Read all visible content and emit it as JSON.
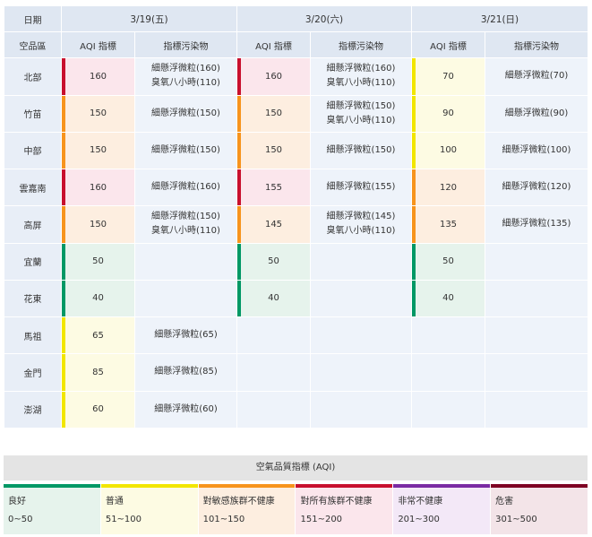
{
  "header": {
    "date_label": "日期",
    "area_label": "空品區",
    "aqi_label": "AQI 指標",
    "pollutant_label": "指標污染物"
  },
  "dates": [
    "3/19(五)",
    "3/20(六)",
    "3/21(日)"
  ],
  "regions": [
    {
      "name": "北部",
      "days": [
        {
          "aqi": "160",
          "color": "#c8102e",
          "bg": "#fbe6ec",
          "pollutants": [
            "細懸浮微粒(160)",
            "臭氧八小時(110)"
          ]
        },
        {
          "aqi": "160",
          "color": "#c8102e",
          "bg": "#fbe6ec",
          "pollutants": [
            "細懸浮微粒(160)",
            "臭氧八小時(110)"
          ]
        },
        {
          "aqi": "70",
          "color": "#f2e600",
          "bg": "#fdfbe3",
          "pollutants": [
            "細懸浮微粒(70)"
          ]
        }
      ]
    },
    {
      "name": "竹苗",
      "days": [
        {
          "aqi": "150",
          "color": "#f7941d",
          "bg": "#fdeee0",
          "pollutants": [
            "細懸浮微粒(150)"
          ]
        },
        {
          "aqi": "150",
          "color": "#f7941d",
          "bg": "#fdeee0",
          "pollutants": [
            "細懸浮微粒(150)",
            "臭氧八小時(110)"
          ]
        },
        {
          "aqi": "90",
          "color": "#f2e600",
          "bg": "#fdfbe3",
          "pollutants": [
            "細懸浮微粒(90)"
          ]
        }
      ]
    },
    {
      "name": "中部",
      "days": [
        {
          "aqi": "150",
          "color": "#f7941d",
          "bg": "#fdeee0",
          "pollutants": [
            "細懸浮微粒(150)"
          ]
        },
        {
          "aqi": "150",
          "color": "#f7941d",
          "bg": "#fdeee0",
          "pollutants": [
            "細懸浮微粒(150)"
          ]
        },
        {
          "aqi": "100",
          "color": "#f2e600",
          "bg": "#fdfbe3",
          "pollutants": [
            "細懸浮微粒(100)"
          ]
        }
      ]
    },
    {
      "name": "雲嘉南",
      "days": [
        {
          "aqi": "160",
          "color": "#c8102e",
          "bg": "#fbe6ec",
          "pollutants": [
            "細懸浮微粒(160)"
          ]
        },
        {
          "aqi": "155",
          "color": "#c8102e",
          "bg": "#fbe6ec",
          "pollutants": [
            "細懸浮微粒(155)"
          ]
        },
        {
          "aqi": "120",
          "color": "#f7941d",
          "bg": "#fdeee0",
          "pollutants": [
            "細懸浮微粒(120)"
          ]
        }
      ]
    },
    {
      "name": "高屏",
      "days": [
        {
          "aqi": "150",
          "color": "#f7941d",
          "bg": "#fdeee0",
          "pollutants": [
            "細懸浮微粒(150)",
            "臭氧八小時(110)"
          ]
        },
        {
          "aqi": "145",
          "color": "#f7941d",
          "bg": "#fdeee0",
          "pollutants": [
            "細懸浮微粒(145)",
            "臭氧八小時(110)"
          ]
        },
        {
          "aqi": "135",
          "color": "#f7941d",
          "bg": "#fdeee0",
          "pollutants": [
            "細懸浮微粒(135)"
          ]
        }
      ]
    },
    {
      "name": "宜蘭",
      "days": [
        {
          "aqi": "50",
          "color": "#009865",
          "bg": "#e6f3ec",
          "pollutants": []
        },
        {
          "aqi": "50",
          "color": "#009865",
          "bg": "#e6f3ec",
          "pollutants": []
        },
        {
          "aqi": "50",
          "color": "#009865",
          "bg": "#e6f3ec",
          "pollutants": []
        }
      ]
    },
    {
      "name": "花東",
      "days": [
        {
          "aqi": "40",
          "color": "#009865",
          "bg": "#e6f3ec",
          "pollutants": []
        },
        {
          "aqi": "40",
          "color": "#009865",
          "bg": "#e6f3ec",
          "pollutants": []
        },
        {
          "aqi": "40",
          "color": "#009865",
          "bg": "#e6f3ec",
          "pollutants": []
        }
      ]
    },
    {
      "name": "馬祖",
      "days": [
        {
          "aqi": "65",
          "color": "#f2e600",
          "bg": "#fdfbe3",
          "pollutants": [
            "細懸浮微粒(65)"
          ]
        },
        null,
        null
      ]
    },
    {
      "name": "金門",
      "days": [
        {
          "aqi": "85",
          "color": "#f2e600",
          "bg": "#fdfbe3",
          "pollutants": [
            "細懸浮微粒(85)"
          ]
        },
        null,
        null
      ]
    },
    {
      "name": "澎湖",
      "days": [
        {
          "aqi": "60",
          "color": "#f2e600",
          "bg": "#fdfbe3",
          "pollutants": [
            "細懸浮微粒(60)"
          ]
        },
        null,
        null
      ]
    }
  ],
  "legend": {
    "title": "空氣品質指標 (AQI)",
    "categories": [
      {
        "label": "良好",
        "range": "0~50",
        "color": "#009865",
        "bg": "#e6f3ec"
      },
      {
        "label": "普通",
        "range": "51~100",
        "color": "#f2e600",
        "bg": "#fdfbe3"
      },
      {
        "label": "對敏感族群不健康",
        "range": "101~150",
        "color": "#f7941d",
        "bg": "#fdeee0"
      },
      {
        "label": "對所有族群不健康",
        "range": "151~200",
        "color": "#c8102e",
        "bg": "#fbe6ec"
      },
      {
        "label": "非常不健康",
        "range": "201~300",
        "color": "#7a2ba3",
        "bg": "#f3e8f7"
      },
      {
        "label": "危害",
        "range": "301~500",
        "color": "#7e0023",
        "bg": "#f3e4e8"
      }
    ]
  }
}
